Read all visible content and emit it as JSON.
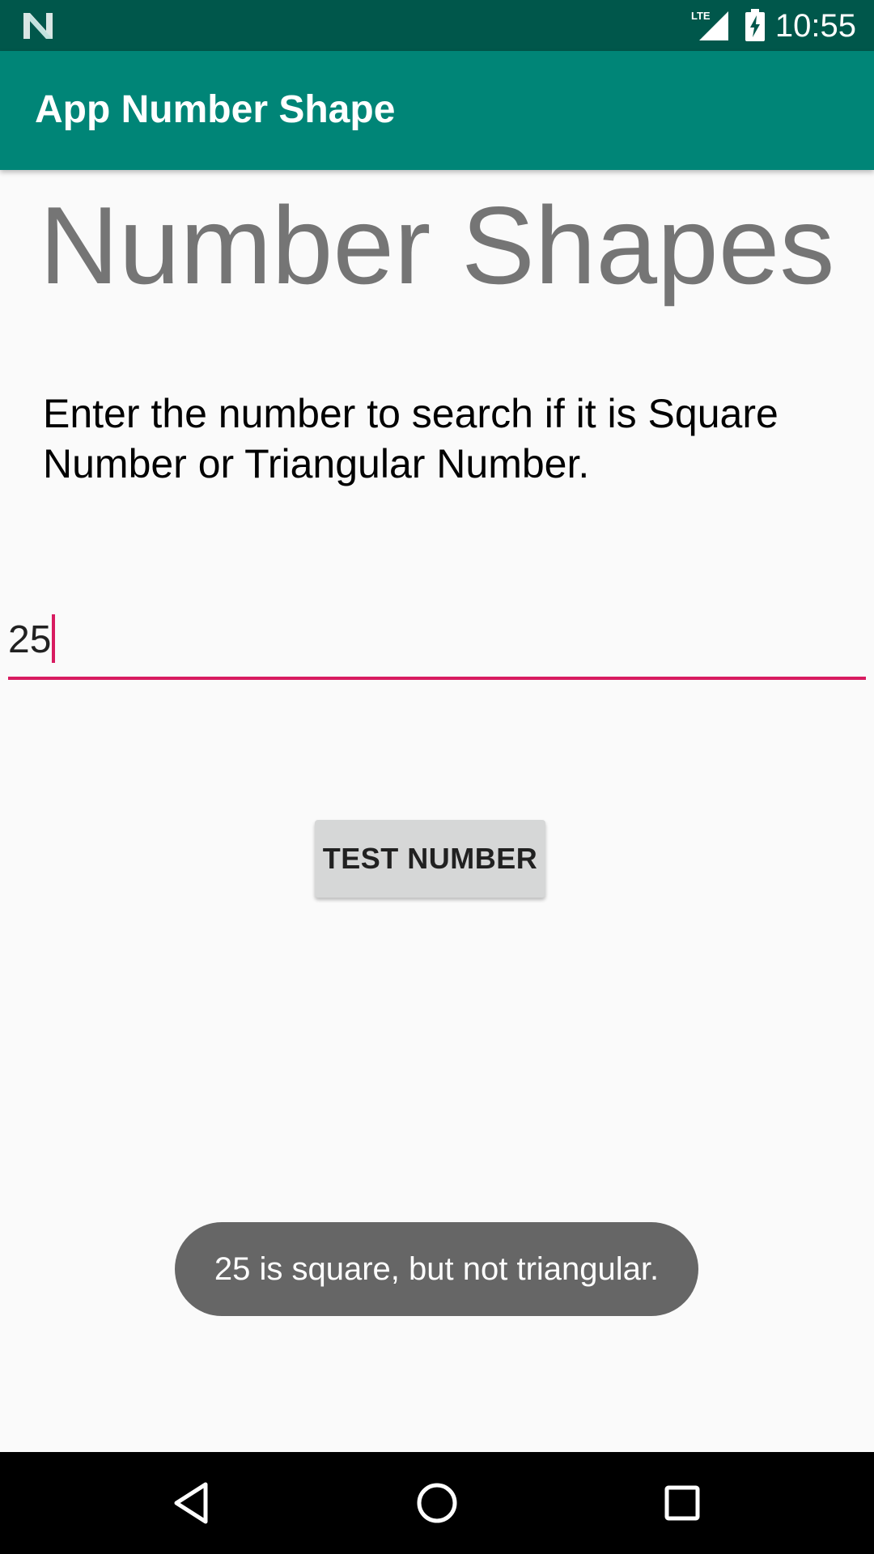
{
  "status_bar": {
    "time": "10:55",
    "network": "LTE",
    "icons": [
      "android-n-logo-icon",
      "lte-signal-icon",
      "battery-charging-icon"
    ]
  },
  "app_bar": {
    "title": "App Number Shape",
    "color": "#008577"
  },
  "main": {
    "heading": "Number Shapes",
    "instructions": "Enter the number to search if it is Square Number or Triangular Number.",
    "number_input": {
      "value": "25",
      "accent_color": "#d81b60"
    },
    "test_button_label": "TEST NUMBER"
  },
  "toast": {
    "message": "25 is square, but not triangular."
  },
  "nav_bar": {
    "icons": [
      "back-icon",
      "home-icon",
      "recents-icon"
    ]
  },
  "colors": {
    "status_bar": "#00574b",
    "app_bar": "#008577",
    "accent": "#d81b60",
    "background": "#fafafa"
  }
}
